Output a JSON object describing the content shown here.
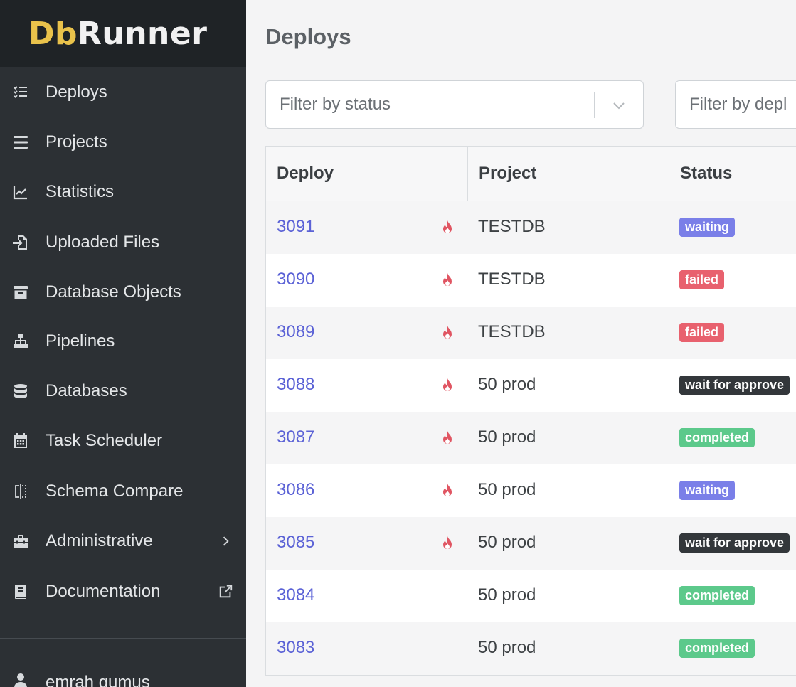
{
  "brand": {
    "part1": "Db",
    "part2": "Runner"
  },
  "sidebar": {
    "items": [
      {
        "label": "Deploys",
        "icon": "list-check-icon"
      },
      {
        "label": "Projects",
        "icon": "bars-icon"
      },
      {
        "label": "Statistics",
        "icon": "chart-line-icon"
      },
      {
        "label": "Uploaded Files",
        "icon": "file-import-icon"
      },
      {
        "label": "Database Objects",
        "icon": "archive-box-icon"
      },
      {
        "label": "Pipelines",
        "icon": "sitemap-icon"
      },
      {
        "label": "Databases",
        "icon": "database-icon"
      },
      {
        "label": "Task Scheduler",
        "icon": "calendar-icon"
      },
      {
        "label": "Schema Compare",
        "icon": "compare-columns-icon"
      },
      {
        "label": "Administrative",
        "icon": "toolbox-icon",
        "trail": "chevron-right-icon"
      },
      {
        "label": "Documentation",
        "icon": "book-icon",
        "trail": "external-link-icon"
      }
    ],
    "user": {
      "name": "emrah gumus",
      "icon": "user-icon"
    }
  },
  "main": {
    "title": "Deploys",
    "filters": {
      "status_placeholder": "Filter by status",
      "deploy_placeholder": "Filter by depl"
    },
    "table": {
      "columns": [
        "Deploy",
        "Project",
        "Status"
      ],
      "rows": [
        {
          "id": "3091",
          "fire": true,
          "project": "TESTDB",
          "status": "waiting"
        },
        {
          "id": "3090",
          "fire": true,
          "project": "TESTDB",
          "status": "failed"
        },
        {
          "id": "3089",
          "fire": true,
          "project": "TESTDB",
          "status": "failed"
        },
        {
          "id": "3088",
          "fire": true,
          "project": "50 prod",
          "status": "wait for approve"
        },
        {
          "id": "3087",
          "fire": true,
          "project": "50 prod",
          "status": "completed"
        },
        {
          "id": "3086",
          "fire": true,
          "project": "50 prod",
          "status": "waiting"
        },
        {
          "id": "3085",
          "fire": true,
          "project": "50 prod",
          "status": "wait for approve"
        },
        {
          "id": "3084",
          "fire": false,
          "project": "50 prod",
          "status": "completed"
        },
        {
          "id": "3083",
          "fire": false,
          "project": "50 prod",
          "status": "completed"
        }
      ]
    }
  },
  "colors": {
    "sidebar_bg": "#2c3034",
    "brand_accent": "#e9c24b",
    "link": "#5b62d6",
    "fire": "#e05562",
    "waiting": "#7a7fe8",
    "failed": "#e8616e",
    "wait_for_approve": "#33373b",
    "completed": "#5cc98b"
  }
}
